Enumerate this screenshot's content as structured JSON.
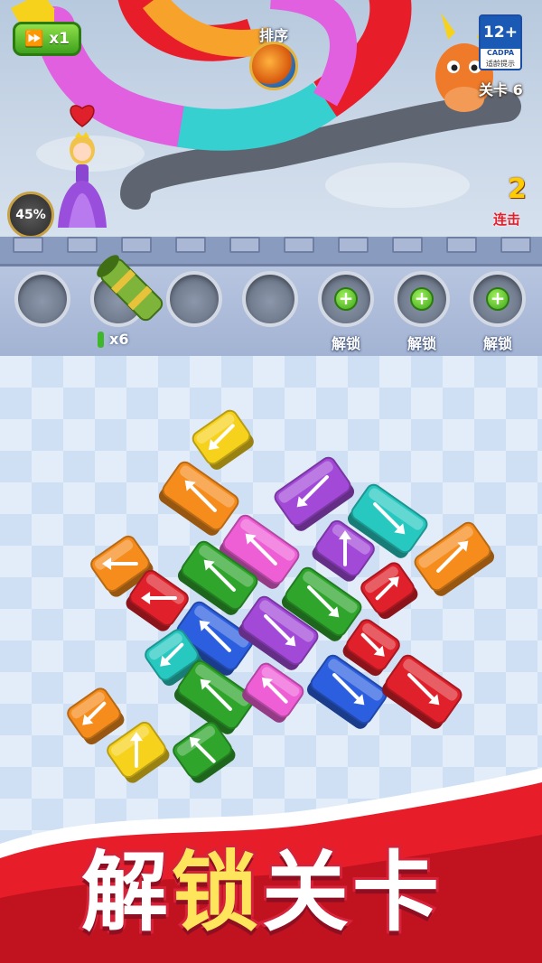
{
  "hud": {
    "speed_label": "x1",
    "sort_label": "排序",
    "level_label": "关卡 6",
    "combo_count": "2",
    "combo_label": "连击",
    "progress_percent": "45%"
  },
  "age_rating": {
    "rating": "12+",
    "org": "CADPA",
    "tip": "适龄提示"
  },
  "slots": [
    {
      "state": "empty"
    },
    {
      "state": "cannon",
      "ammo": "x6"
    },
    {
      "state": "empty"
    },
    {
      "state": "empty"
    },
    {
      "state": "locked",
      "label": "解锁"
    },
    {
      "state": "locked",
      "label": "解锁"
    },
    {
      "state": "locked",
      "label": "解锁"
    }
  ],
  "banner": {
    "chars": [
      "解",
      "锁",
      "关",
      "卡"
    ]
  },
  "colors": {
    "yellow": "#f7d21c",
    "orange": "#f58c1c",
    "purple": "#a249d8",
    "teal": "#27c8c0",
    "pink": "#ee5fd6",
    "green": "#2fa52c",
    "red": "#e0202a",
    "blue": "#2c5fe0"
  },
  "pieces": [
    {
      "color": "yellow",
      "dir": "down-left"
    },
    {
      "color": "orange",
      "dir": "up-left"
    },
    {
      "color": "purple",
      "dir": "down-left"
    },
    {
      "color": "teal",
      "dir": "down-right"
    },
    {
      "color": "pink",
      "dir": "up-left"
    },
    {
      "color": "purple",
      "dir": "up"
    },
    {
      "color": "orange",
      "dir": "up-right"
    },
    {
      "color": "orange",
      "dir": "left"
    },
    {
      "color": "green",
      "dir": "up-left"
    },
    {
      "color": "green",
      "dir": "down-right"
    },
    {
      "color": "red",
      "dir": "up-right"
    },
    {
      "color": "red",
      "dir": "left"
    },
    {
      "color": "blue",
      "dir": "up-left"
    },
    {
      "color": "purple",
      "dir": "down-right"
    },
    {
      "color": "red",
      "dir": "down-right"
    },
    {
      "color": "teal",
      "dir": "down-left"
    },
    {
      "color": "green",
      "dir": "up-left"
    },
    {
      "color": "pink",
      "dir": "up-left"
    },
    {
      "color": "blue",
      "dir": "down-right"
    },
    {
      "color": "red",
      "dir": "down-right"
    },
    {
      "color": "orange",
      "dir": "down-left"
    },
    {
      "color": "yellow",
      "dir": "up"
    },
    {
      "color": "green",
      "dir": "up-left"
    }
  ]
}
